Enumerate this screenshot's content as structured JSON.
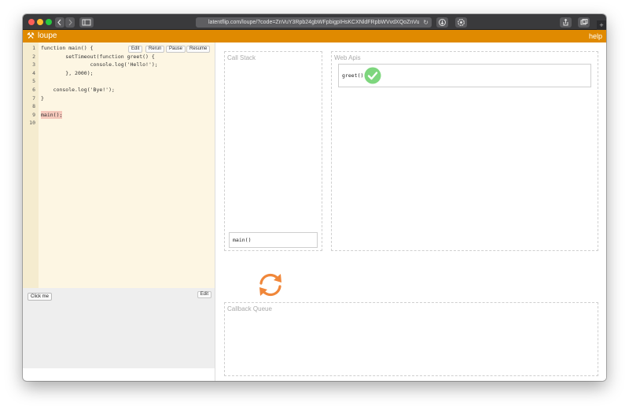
{
  "browser": {
    "url": "latentflip.com/loupe/?code=ZnVuY3Rpb24gbWFpbigpIHsKCXNldFRpbWVvdXQoZnVuY3Rpb24gZ3JlZXQoKSB7",
    "back_icon": "chevron-left-icon",
    "forward_icon": "chevron-right-icon",
    "sidebar_icon": "sidebar-icon",
    "reload_icon": "reload-icon",
    "share_icon": "share-icon",
    "tabs_icon": "tabs-icon",
    "new_tab": "+"
  },
  "app": {
    "title": "loupe",
    "help": "help",
    "logo_icon": "tools-icon",
    "accent_color": "#e08a00"
  },
  "editor": {
    "buttons": {
      "edit": "Edit",
      "rerun": "Rerun",
      "pause": "Pause",
      "resume": "Resume"
    },
    "lines": [
      {
        "no": "1",
        "code": "function main() {"
      },
      {
        "no": "2",
        "code": "        setTimeout(function greet() {"
      },
      {
        "no": "3",
        "code": "                console.log('Hello!');"
      },
      {
        "no": "4",
        "code": "        }, 2000);"
      },
      {
        "no": "5",
        "code": ""
      },
      {
        "no": "6",
        "code": "    console.log('Bye!');"
      },
      {
        "no": "7",
        "code": "}"
      },
      {
        "no": "8",
        "code": ""
      },
      {
        "no": "9",
        "code": "main();"
      },
      {
        "no": "10",
        "code": ""
      }
    ]
  },
  "html_pane": {
    "click_me": "Click me",
    "edit": "Edit"
  },
  "call_stack": {
    "title": "Call Stack",
    "frames": [
      "main()"
    ]
  },
  "web_apis": {
    "title": "Web Apis",
    "items": [
      {
        "label": "greet()",
        "status_icon": "check-circle-icon",
        "status_color": "#7ed67e"
      }
    ]
  },
  "callback_queue": {
    "title": "Callback Queue"
  },
  "event_loop": {
    "icon": "event-loop-refresh-icon",
    "color": "#f0873a"
  }
}
